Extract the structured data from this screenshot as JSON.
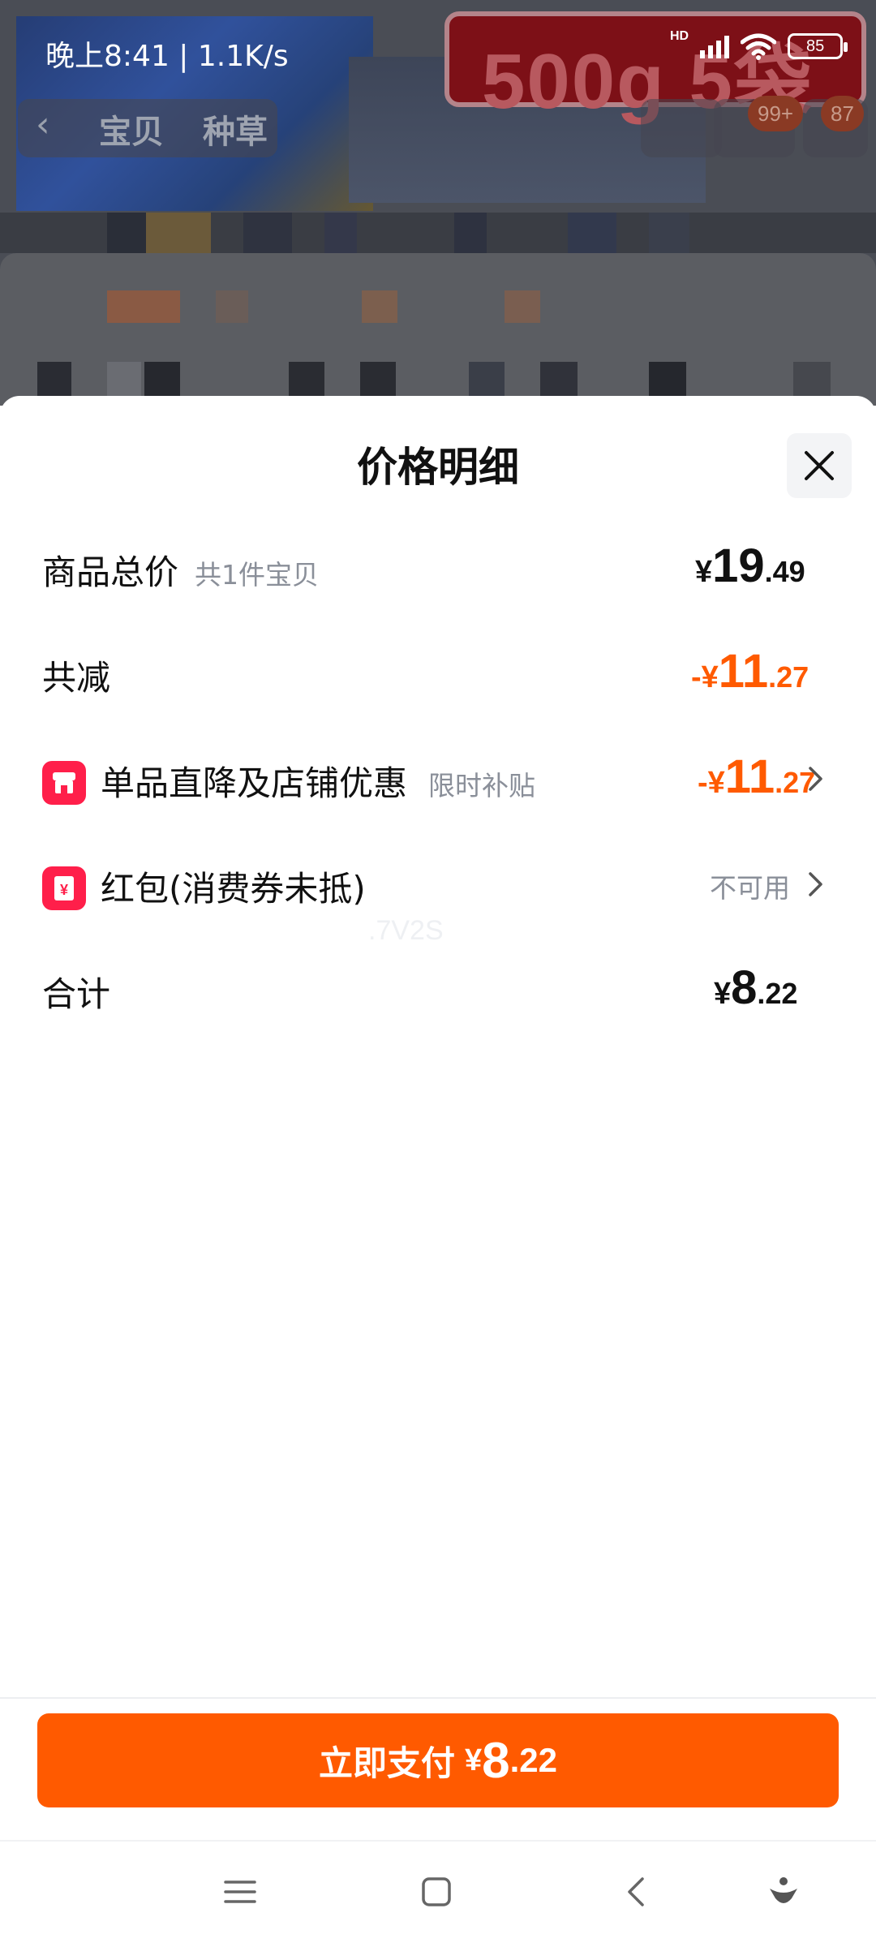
{
  "status_bar": {
    "time": "晚上8:41 | 1.1K/s",
    "network_label": "HD",
    "battery": "85"
  },
  "background_page": {
    "banner_text": "500g 5袋",
    "tabs": [
      "宝贝",
      "种草"
    ],
    "cart_badge": "99+",
    "more_badge": "87"
  },
  "sheet": {
    "title": "价格明细",
    "rows": [
      {
        "label": "商品总价",
        "sub": "共1件宝贝",
        "price_symbol": "¥",
        "price_int": "19",
        "price_dec": ".49"
      },
      {
        "label": "共减",
        "price_symbol": "-¥",
        "price_int": "11",
        "price_dec": ".27"
      },
      {
        "label": "单品直降及店铺优惠",
        "sub": "限时补贴",
        "icon": "shop-icon",
        "price_symbol": "-¥",
        "price_int": "11",
        "price_dec": ".27"
      },
      {
        "label": "红包(消费券未抵)",
        "icon": "red-packet-icon",
        "status": "不可用"
      },
      {
        "label": "合计",
        "price_symbol": "¥",
        "price_int": "8",
        "price_dec": ".22"
      }
    ],
    "watermark": ".7V2S"
  },
  "pay_button": {
    "label": "立即支付",
    "symbol": "¥",
    "int": "8",
    "dec": ".22"
  },
  "colors": {
    "accent": "#ff5a00",
    "badge_red": "#ff1f4a",
    "muted_text": "#8a8f99"
  }
}
